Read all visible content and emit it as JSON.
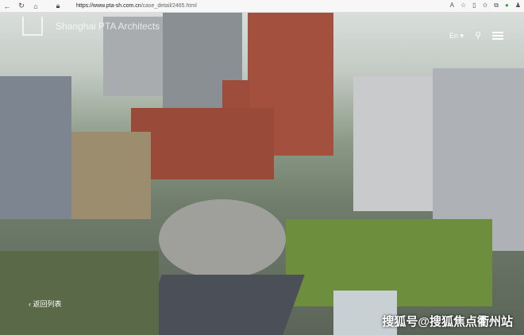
{
  "browser": {
    "url_domain": "https://www.pta-sh.com.cn",
    "url_path": "/case_detail/2465.html"
  },
  "site": {
    "brand": "Shanghai PTA Architects",
    "lang": "En",
    "lang_caret": "▾"
  },
  "page": {
    "back_label": "返回列表"
  },
  "watermark": "搜狐号@搜狐焦点衢州站"
}
